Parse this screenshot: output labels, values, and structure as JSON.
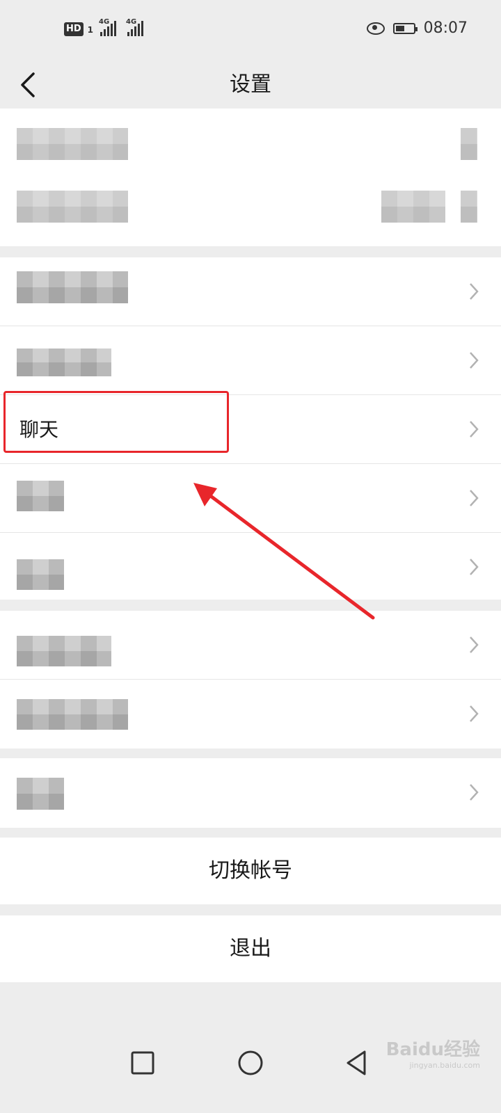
{
  "status_bar": {
    "hd_label": "HD",
    "sim_number": "1",
    "net1": "4G",
    "net2": "4G",
    "time": "08:07"
  },
  "header": {
    "title": "设置"
  },
  "menu": {
    "chat_label": "聊天"
  },
  "actions": {
    "switch_account": "切换帐号",
    "logout": "退出"
  },
  "watermark": {
    "brand": "Baidu经验",
    "url": "jingyan.baidu.com"
  },
  "colors": {
    "background": "#ededed",
    "card": "#ffffff",
    "highlight": "#e8262b"
  }
}
